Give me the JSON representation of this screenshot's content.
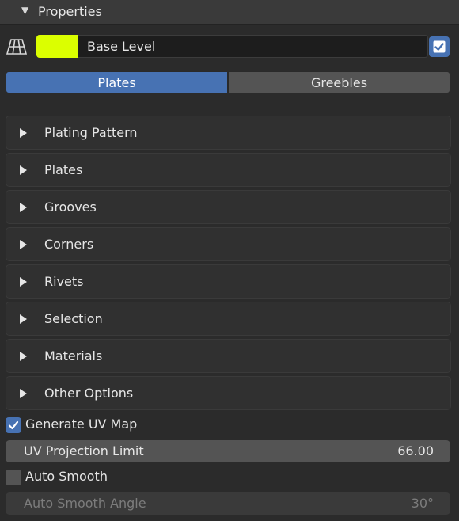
{
  "header": {
    "title": "Properties"
  },
  "level": {
    "name": "Base Level",
    "color": "#dbff00",
    "enabled": true
  },
  "tabs": [
    {
      "label": "Plates",
      "active": true
    },
    {
      "label": "Greebles",
      "active": false
    }
  ],
  "panels": [
    {
      "label": "Plating Pattern"
    },
    {
      "label": "Plates"
    },
    {
      "label": "Grooves"
    },
    {
      "label": "Corners"
    },
    {
      "label": "Rivets"
    },
    {
      "label": "Selection"
    },
    {
      "label": "Materials"
    },
    {
      "label": "Other Options"
    }
  ],
  "options": {
    "generate_uv": {
      "label": "Generate UV Map",
      "checked": true
    },
    "uv_limit": {
      "label": "UV Projection Limit",
      "value": "66.00"
    },
    "auto_smooth": {
      "label": "Auto Smooth",
      "checked": false
    },
    "smooth_angle": {
      "label": "Auto Smooth Angle",
      "value": "30°"
    }
  },
  "colors": {
    "accent": "#4772b3",
    "background": "#2b2b2b",
    "panel": "#303030"
  }
}
